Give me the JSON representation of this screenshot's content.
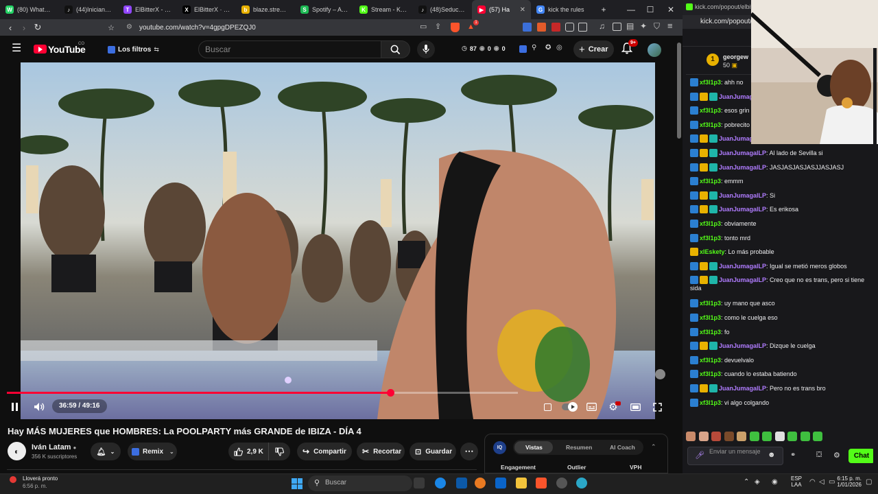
{
  "browser": {
    "tabs": [
      {
        "title": "(80) WhatsApp",
        "color": "#25d366",
        "glyph": "W"
      },
      {
        "title": "(44)Iniciando m",
        "color": "#111111",
        "glyph": "♪"
      },
      {
        "title": "ElBitterX - Twit",
        "color": "#9146ff",
        "glyph": "T"
      },
      {
        "title": "ElBitterX · on",
        "color": "#000000",
        "glyph": "X"
      },
      {
        "title": "blaze.stream/s",
        "color": "#e8b100",
        "glyph": "b"
      },
      {
        "title": "Spotify – Anun",
        "color": "#1db954",
        "glyph": "S"
      },
      {
        "title": "Stream - Kick",
        "color": "#53fc18",
        "glyph": "K"
      },
      {
        "title": "(48)SeduceLa",
        "color": "#111111",
        "glyph": "♪"
      },
      {
        "title": "(57) Ha",
        "color": "#ff0033",
        "glyph": "▶"
      },
      {
        "title": "kick the rules",
        "color": "#4285f4",
        "glyph": "G"
      }
    ],
    "active_tab": 8,
    "url": "youtube.com/watch?v=4gpgDPEZQJ0",
    "brave_badge": "1"
  },
  "youtube": {
    "logo": "YouTube",
    "country": "CO",
    "filters_label": "Los filtros",
    "search_placeholder": "Buscar",
    "stats": {
      "views_icon_count": "87",
      "eye_count": "0",
      "eye2_count": "0"
    },
    "create_label": "Crear",
    "notifications_badge": "9+",
    "video": {
      "time_current": "36:59",
      "time_total": "49:16",
      "time_display": "36:59 / 49:16",
      "progress_fraction": 0.7506,
      "buffer_fraction": 1.0
    },
    "title": "Hay MÁS MUJERES que HOMBRES: La POOLPARTY más GRANDE de IBIZA - DÍA 4",
    "channel": {
      "name": "Iván Latam",
      "subscribers": "356 K suscriptores"
    },
    "remix_label": "Remix",
    "likes": "2,9 K",
    "share_label": "Compartir",
    "clip_label": "Recortar",
    "save_label": "Guardar",
    "ext_panel": {
      "tabs": [
        "Vistas",
        "Resumen",
        "AI Coach"
      ],
      "active_tab": 0,
      "columns": [
        "Engagement",
        "Outlier",
        "VPH"
      ]
    }
  },
  "chat": {
    "url": "kick.com/popout/elbitt",
    "url2": "kick.com/popout/",
    "top_user": "georgew",
    "top_rank": "1",
    "top_points": "50",
    "messages": [
      {
        "user": "xf3l1p3",
        "text": "ahh no",
        "color": "#53fc18",
        "badges": 1
      },
      {
        "user": "JuanJumagalLP",
        "text": "",
        "color": "#b07cff",
        "badges": 3
      },
      {
        "user": "xf3l1p3",
        "text": "esos grin",
        "color": "#53fc18",
        "badges": 1
      },
      {
        "user": "xf3l1p3",
        "text": "pobrecito",
        "color": "#53fc18",
        "badges": 1
      },
      {
        "user": "JuanJumagalLP",
        "text": "JASJASJASJASJASJSJA",
        "color": "#b07cff",
        "badges": 3
      },
      {
        "user": "JuanJumagalLP",
        "text": "Al lado de Sevilla si",
        "color": "#b07cff",
        "badges": 3
      },
      {
        "user": "JuanJumagalLP",
        "text": "JASJASJASJASJJASJASJ",
        "color": "#b07cff",
        "badges": 3
      },
      {
        "user": "xf3l1p3",
        "text": "emmm",
        "color": "#53fc18",
        "badges": 1
      },
      {
        "user": "JuanJumagalLP",
        "text": "Si",
        "color": "#b07cff",
        "badges": 3
      },
      {
        "user": "JuanJumagalLP",
        "text": "Es erikosa",
        "color": "#b07cff",
        "badges": 3
      },
      {
        "user": "xf3l1p3",
        "text": "obviamente",
        "color": "#53fc18",
        "badges": 1
      },
      {
        "user": "xf3l1p3",
        "text": "tonto mrd",
        "color": "#53fc18",
        "badges": 1
      },
      {
        "user": "xIEskety",
        "text": "Lo más probable",
        "color": "#53fc18",
        "badges": 0
      },
      {
        "user": "JuanJumagalLP",
        "text": "Igual se metió meros globos",
        "color": "#b07cff",
        "badges": 3
      },
      {
        "user": "JuanJumagalLP",
        "text": "Creo que no es trans, pero si tiene sida",
        "color": "#b07cff",
        "badges": 3
      },
      {
        "user": "xf3l1p3",
        "text": "uy mano que asco",
        "color": "#53fc18",
        "badges": 1
      },
      {
        "user": "xf3l1p3",
        "text": "como le cuelga eso",
        "color": "#53fc18",
        "badges": 1
      },
      {
        "user": "xf3l1p3",
        "text": "fo",
        "color": "#53fc18",
        "badges": 1
      },
      {
        "user": "JuanJumagalLP",
        "text": "Dizque le cuelga",
        "color": "#b07cff",
        "badges": 3
      },
      {
        "user": "xf3l1p3",
        "text": "devuelvalo",
        "color": "#53fc18",
        "badges": 1
      },
      {
        "user": "xf3l1p3",
        "text": "cuando lo estaba batiendo",
        "color": "#53fc18",
        "badges": 1
      },
      {
        "user": "JuanJumagalLP",
        "text": "Pero no es trans bro",
        "color": "#b07cff",
        "badges": 3
      },
      {
        "user": "xf3l1p3",
        "text": "vi algo colgando",
        "color": "#53fc18",
        "badges": 1
      }
    ],
    "input_placeholder": "Enviar un mensaje",
    "send_label": "Chat"
  },
  "taskbar": {
    "weather_title": "Lloverá pronto",
    "weather_time": "6:56 p. m.",
    "search_label": "Buscar",
    "lang": "ESP",
    "lang2": "LAA",
    "clock_time": "6:15 p. m.",
    "clock_date": "1/01/2026"
  }
}
